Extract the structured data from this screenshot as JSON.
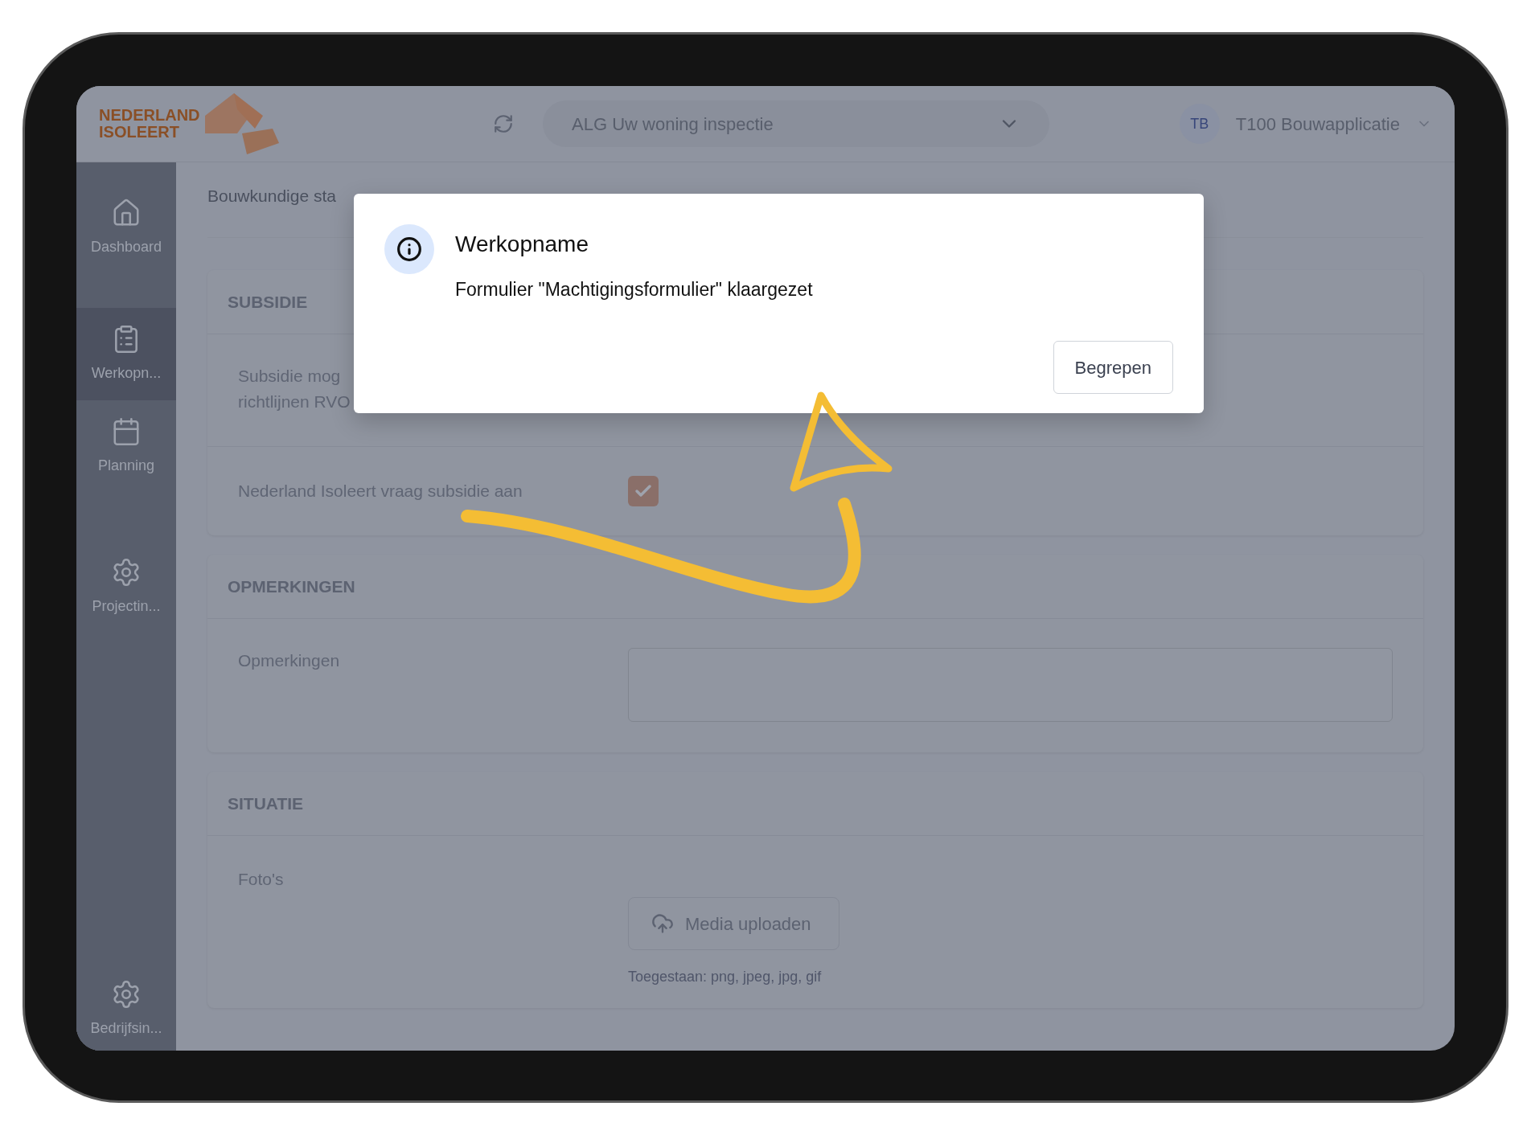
{
  "logo": {
    "line_1": "NEDERLAND",
    "line_2": "ISOLEERT"
  },
  "header": {
    "project_select": {
      "value": "ALG Uw woning inspectie"
    },
    "user": {
      "initials": "TB",
      "name": "T100 Bouwapplicatie"
    }
  },
  "sidebar": {
    "items": [
      {
        "label": "Dashboard",
        "selected": false
      },
      {
        "label": "Werkopn...",
        "selected": true
      },
      {
        "label": "Planning",
        "selected": false
      },
      {
        "label": "Projectin...",
        "selected": false
      },
      {
        "label": "Bedrijfsin...",
        "selected": false
      }
    ]
  },
  "tabs": [
    {
      "label": "Bouwkundige sta",
      "selected": false
    }
  ],
  "sections": [
    {
      "title": "SUBSIDIE",
      "fields": [
        {
          "kind": "text",
          "lines": [
            "Subsidie mog",
            "richtlijnen RVO"
          ]
        },
        {
          "kind": "checkbox",
          "label": "Nederland Isoleert vraag subsidie aan",
          "checked": true
        }
      ]
    },
    {
      "title": "OPMERKINGEN",
      "fields": [
        {
          "kind": "textarea",
          "label": "Opmerkingen"
        }
      ]
    },
    {
      "title": "SITUATIE",
      "fields": [
        {
          "kind": "upload",
          "label": "Foto's",
          "button": "Media uploaden",
          "hint": "Toegestaan: png, jpeg, jpg, gif"
        }
      ]
    }
  ],
  "dialog": {
    "title": "Werkopname",
    "message": "Formulier \"Machtigingsformulier\" klaargezet",
    "button": "Begrepen"
  }
}
